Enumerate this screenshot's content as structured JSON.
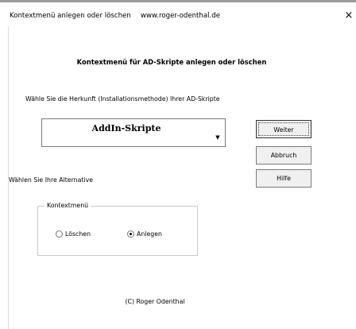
{
  "window": {
    "title": "Kontextmenü anlegen oder löschen",
    "url": "www.roger-odenthal.de",
    "close_glyph": "×"
  },
  "dialog": {
    "heading": "Kontextmenü für AD-Skripte anlegen oder löschen",
    "source_label": "Wähle Sie die Herkunft (Installationsmethode) Ihrer AD-Skripte",
    "source_select": {
      "value": "AddIn-Skripte",
      "arrow_icon": "dropdown-arrow-icon",
      "arrow_glyph": "▼"
    },
    "alternative_label": "Wählen Sie Ihre Alternative",
    "buttons": {
      "next": "Weiter",
      "cancel": "Abbruch",
      "help": "Hilfe"
    },
    "context_frame": {
      "title": "Kontextmenü",
      "options": [
        {
          "label": "Löschen",
          "selected": false
        },
        {
          "label": "Anlegen",
          "selected": true
        }
      ]
    },
    "footer": "(C) Roger Odenthal"
  }
}
